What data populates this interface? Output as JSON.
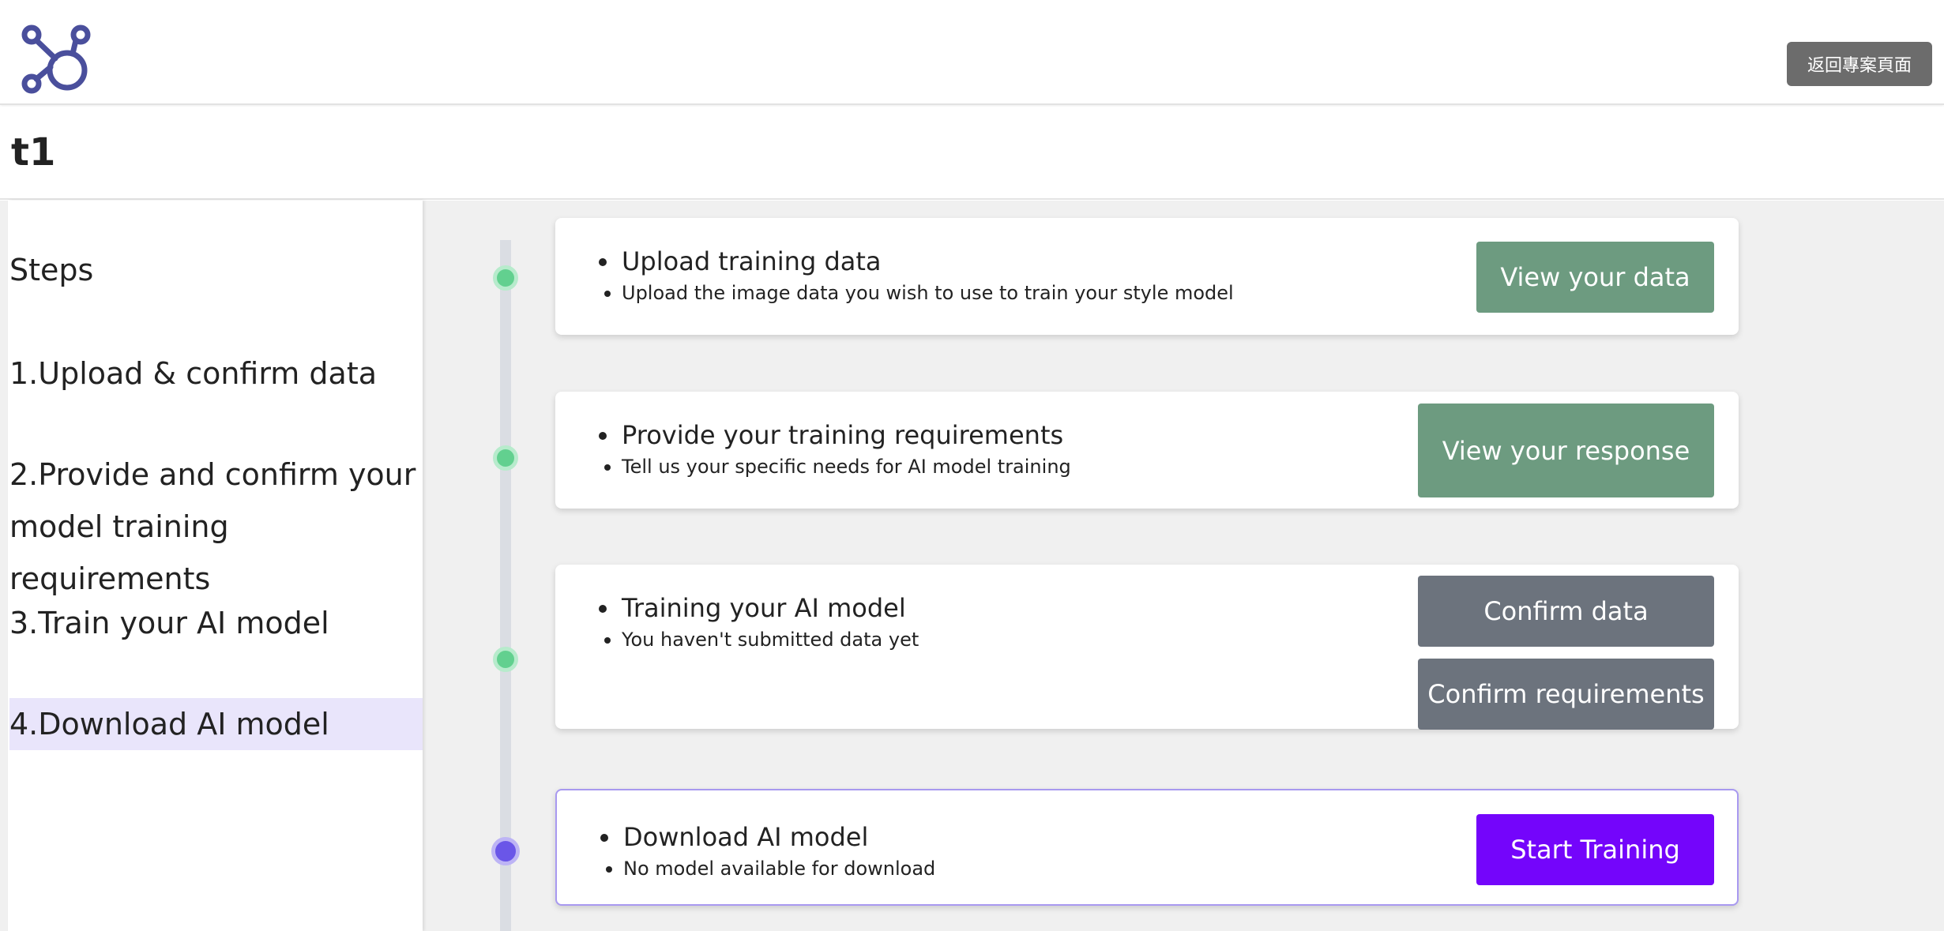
{
  "header": {
    "back_label": "返回專案頁面"
  },
  "page": {
    "title": "t1"
  },
  "sidebar": {
    "heading": "Steps",
    "items": [
      {
        "label": "1.Upload & confirm data"
      },
      {
        "label_line1": "2.Provide and confirm your",
        "label_line2": "model training requirements"
      },
      {
        "label": "3.Train your AI model"
      },
      {
        "label": "4.Download AI model",
        "active": true
      }
    ]
  },
  "steps": [
    {
      "title": "Upload training data",
      "subtitle": "Upload the image data you wish to use to train your style model",
      "buttons": [
        "View your data"
      ],
      "status_color": "#62d08f"
    },
    {
      "title": "Provide your training requirements",
      "subtitle": "Tell us your specific needs for AI model training",
      "buttons": [
        "View your response"
      ],
      "status_color": "#62d08f"
    },
    {
      "title": "Training your AI model",
      "subtitle": "You haven't submitted data yet",
      "buttons": [
        "Confirm data",
        "Confirm requirements"
      ],
      "status_color": "#62d08f"
    },
    {
      "title": "Download AI model",
      "subtitle": "No model available for download",
      "buttons": [
        "Start Training"
      ],
      "status_color": "#6a56e8"
    }
  ],
  "colors": {
    "accent": "#7405fb",
    "done_button": "#6d9b80",
    "pending_button": "#6c737d",
    "active_step_bg": "#e9e5fb"
  },
  "icons": {
    "logo": "network-nodes-logo-icon"
  }
}
